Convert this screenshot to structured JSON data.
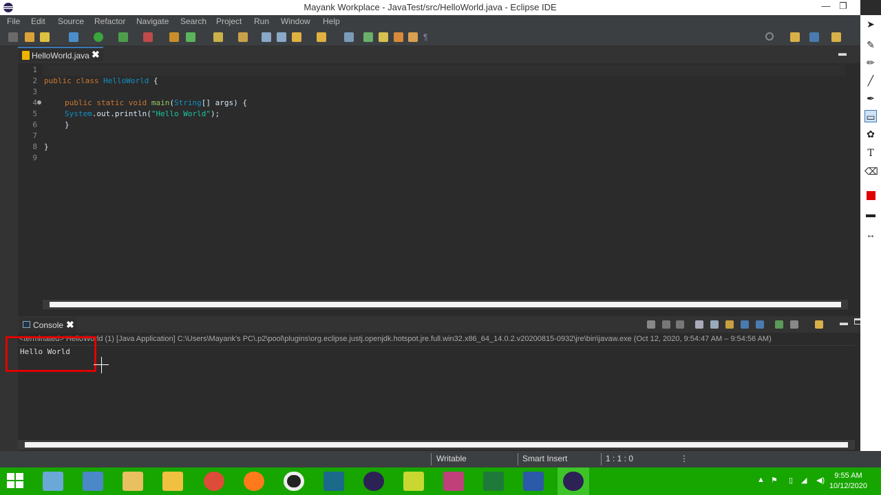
{
  "window": {
    "title": "Mayank Workplace - JavaTest/src/HelloWorld.java - Eclipse IDE",
    "minimize": "—",
    "restore": "❐"
  },
  "menu": [
    "File",
    "Edit",
    "Source",
    "Refactor",
    "Navigate",
    "Search",
    "Project",
    "Run",
    "Window",
    "Help"
  ],
  "editor": {
    "tab_label": "HelloWorld.java",
    "tab_close": "✖",
    "line_numbers": [
      "1",
      "2",
      "3",
      "4",
      "5",
      "6",
      "7",
      "8",
      "9"
    ],
    "code": {
      "l2_kw": "public class ",
      "l2_cls": "HelloWorld",
      "l2_rest": " {",
      "l4_kw": "public static void ",
      "l4_mth": "main",
      "l4_p1": "(",
      "l4_cls": "String",
      "l4_rest": "[] args) {",
      "l5_cls": "System",
      "l5_mid": ".out.println(",
      "l5_str": "\"Hello World\"",
      "l5_end": ");",
      "l6": "}",
      "l8": "}"
    }
  },
  "console": {
    "tab_label": "Console",
    "tab_close": "✖",
    "info": "<terminated> HelloWorld (1) [Java Application] C:\\Users\\Mayank's PC\\.p2\\pool\\plugins\\org.eclipse.justj.openjdk.hotspot.jre.full.win32.x86_64_14.0.2.v20200815-0932\\jre\\bin\\javaw.exe  (Oct 12, 2020, 9:54:47 AM – 9:54:56 AM)",
    "output": "Hello World"
  },
  "status": {
    "writable": "Writable",
    "insert_mode": "Smart Insert",
    "position": "1 : 1 : 0"
  },
  "taskbar": {
    "time": "9:55 AM",
    "date": "10/12/2020"
  },
  "colors": {
    "highlight": "#e00000",
    "taskbar": "#17a500",
    "keyword": "#cc7832"
  }
}
